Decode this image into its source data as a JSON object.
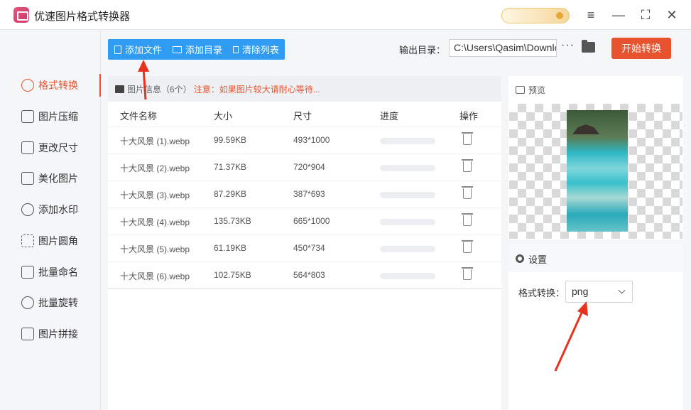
{
  "app": {
    "title": "优速图片格式转换器"
  },
  "window_controls": {
    "menu": "≡",
    "minimize": "—",
    "maximize": "⛶",
    "close": "✕"
  },
  "sidebar": {
    "items": [
      {
        "label": "格式转换",
        "icon": "convert-icon",
        "active": true
      },
      {
        "label": "图片压缩",
        "icon": "compress-icon"
      },
      {
        "label": "更改尺寸",
        "icon": "resize-icon"
      },
      {
        "label": "美化图片",
        "icon": "beautify-icon"
      },
      {
        "label": "添加水印",
        "icon": "watermark-icon"
      },
      {
        "label": "图片圆角",
        "icon": "rounded-corner-icon"
      },
      {
        "label": "批量命名",
        "icon": "rename-icon"
      },
      {
        "label": "批量旋转",
        "icon": "rotate-icon"
      },
      {
        "label": "图片拼接",
        "icon": "stitch-icon"
      }
    ]
  },
  "toolbar": {
    "add_file": "添加文件",
    "add_folder": "添加目录",
    "clear_list": "清除列表",
    "output_label": "输出目录：",
    "output_path": "C:\\Users\\Qasim\\Downloads",
    "more": "···",
    "start": "开始转换"
  },
  "file_panel": {
    "header_title": "图片信息（6个）",
    "header_notice": "注意：如果图片较大请耐心等待...",
    "columns": {
      "name": "文件名称",
      "size": "大小",
      "dimensions": "尺寸",
      "progress": "进度",
      "action": "操作"
    },
    "rows": [
      {
        "name": "十大风景 (1).webp",
        "size": "99.59KB",
        "dimensions": "493*1000",
        "progress": 0
      },
      {
        "name": "十大风景 (2).webp",
        "size": "71.37KB",
        "dimensions": "720*904",
        "progress": 0
      },
      {
        "name": "十大风景 (3).webp",
        "size": "87.29KB",
        "dimensions": "387*693",
        "progress": 0
      },
      {
        "name": "十大风景 (4).webp",
        "size": "135.73KB",
        "dimensions": "665*1000",
        "progress": 0
      },
      {
        "name": "十大风景 (5).webp",
        "size": "61.19KB",
        "dimensions": "450*734",
        "progress": 0
      },
      {
        "name": "十大风景 (6).webp",
        "size": "102.75KB",
        "dimensions": "564*803",
        "progress": 0
      }
    ]
  },
  "preview": {
    "title": "预览"
  },
  "settings": {
    "title": "设置",
    "format_label": "格式转换：",
    "format_value": "png"
  },
  "colors": {
    "accent": "#e8532f",
    "primary_blue": "#2f9bf1",
    "annotation_arrow": "#e8321f"
  }
}
